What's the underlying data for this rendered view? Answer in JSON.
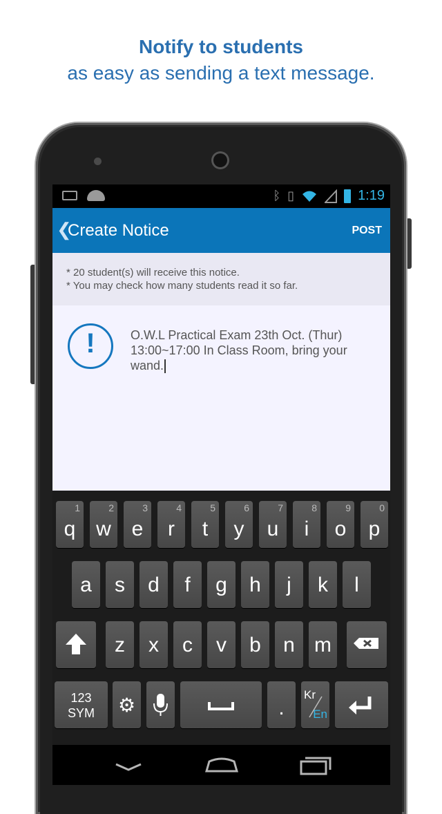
{
  "promo": {
    "headline": "Notify to students",
    "subheadline": "as easy as sending a text message."
  },
  "status_bar": {
    "time": "1:19"
  },
  "action_bar": {
    "back_glyph": "❮",
    "title": "Create Notice",
    "post_label": "POST"
  },
  "info": {
    "line1": "* 20 student(s) will receive this notice.",
    "line2": "* You may check how many students read it so far."
  },
  "notice": {
    "icon": "exclamation-circle-icon",
    "text": "O.W.L Practical Exam 23th Oct. (Thur) 13:00~17:00 In Class Room, bring your wand."
  },
  "keyboard": {
    "row1": [
      {
        "key": "q",
        "hint": "1"
      },
      {
        "key": "w",
        "hint": "2"
      },
      {
        "key": "e",
        "hint": "3"
      },
      {
        "key": "r",
        "hint": "4"
      },
      {
        "key": "t",
        "hint": "5"
      },
      {
        "key": "y",
        "hint": "6"
      },
      {
        "key": "u",
        "hint": "7"
      },
      {
        "key": "i",
        "hint": "8"
      },
      {
        "key": "o",
        "hint": "9"
      },
      {
        "key": "p",
        "hint": "0"
      }
    ],
    "row2": [
      "a",
      "s",
      "d",
      "f",
      "g",
      "h",
      "j",
      "k",
      "l"
    ],
    "row3": [
      "z",
      "x",
      "c",
      "v",
      "b",
      "n",
      "m"
    ],
    "sym_line1": "123",
    "sym_line2": "SYM",
    "period": ".",
    "lang_top": "Kr",
    "lang_bottom": "En",
    "accent_color": "#33b5e5"
  },
  "colors": {
    "action_bar": "#0b75b9",
    "headline": "#2a6fb0"
  }
}
